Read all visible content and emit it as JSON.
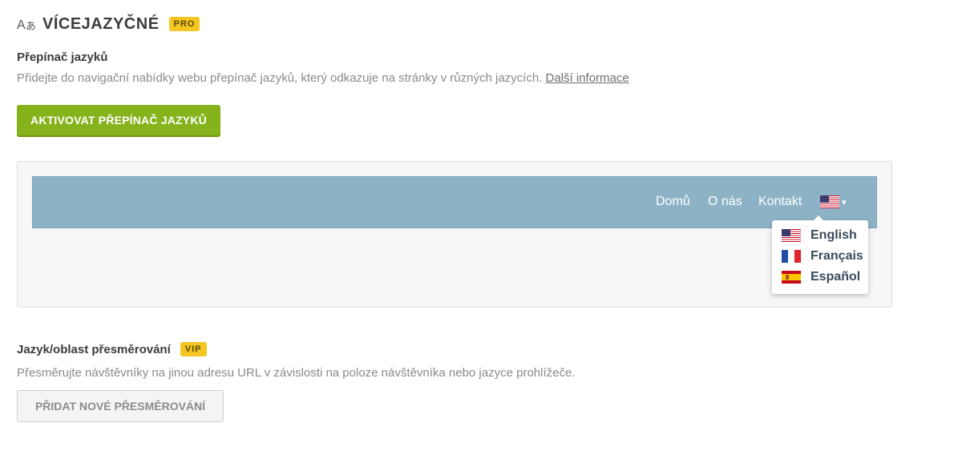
{
  "header": {
    "icon": "translate-icon",
    "title": "VÍCEJAZYČNÉ",
    "badge": "PRO"
  },
  "language_switcher": {
    "title": "Přepínač jazyků",
    "description": "Přidejte do navigační nabídky webu přepínač jazyků, který odkazuje na stránky v různých jazycích.",
    "link_label": "Další informace",
    "button_label": "AKTIVOVAT PŘEPÍNAČ JAZYKŮ"
  },
  "preview": {
    "nav_links": [
      "Domů",
      "O nás",
      "Kontakt"
    ],
    "current_flag": "us-flag-icon",
    "caret": "▾",
    "languages": [
      {
        "flag": "us-flag-icon",
        "label": "English"
      },
      {
        "flag": "fr-flag-icon",
        "label": "Français"
      },
      {
        "flag": "es-flag-icon",
        "label": "Español"
      }
    ]
  },
  "redirect": {
    "title": "Jazyk/oblast přesměrování",
    "badge": "VIP",
    "description": "Přesměrujte návštěvníky na jinou adresu URL v závislosti na poloze návštěvníka nebo jazyce prohlížeče.",
    "button_label": "PŘIDAT NOVÉ PŘESMĚROVÁNÍ"
  },
  "colors": {
    "accent_green": "#86b21b",
    "badge_yellow": "#f3c623",
    "nav_blue": "#8db2c6"
  }
}
